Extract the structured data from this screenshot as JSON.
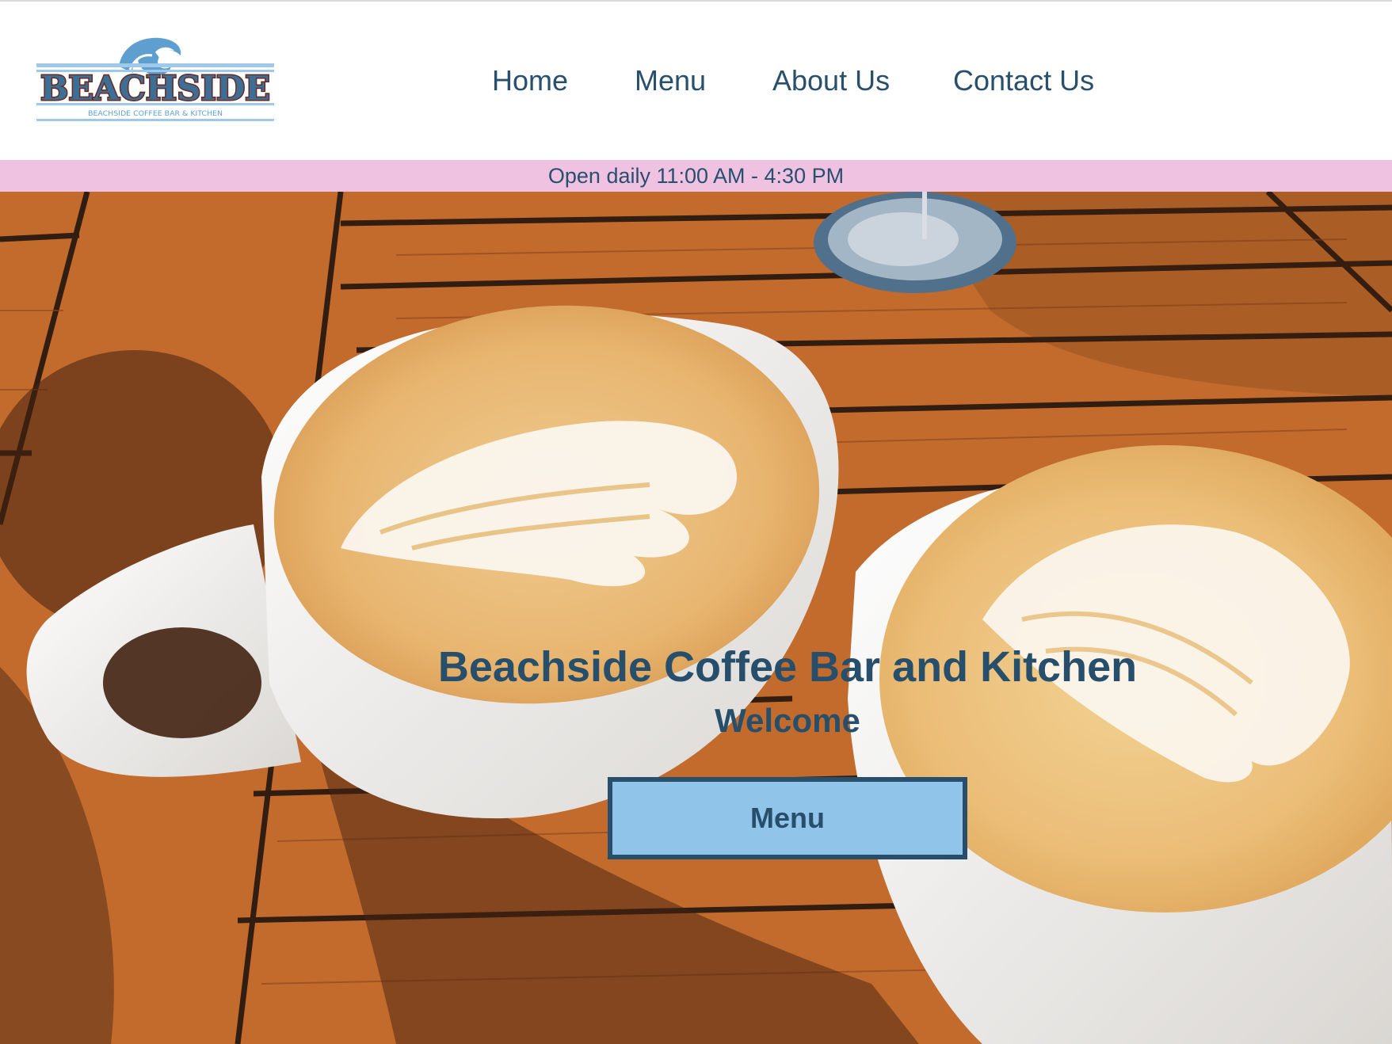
{
  "logo": {
    "wordmark": "BEACHSIDE",
    "tagline": "BEACHSIDE COFFEE BAR & KITCHEN"
  },
  "nav": {
    "items": [
      {
        "label": "Home"
      },
      {
        "label": "Menu"
      },
      {
        "label": "About Us"
      },
      {
        "label": "Contact Us"
      }
    ]
  },
  "hours_banner": "Open daily 11:00 AM - 4:30 PM",
  "hero": {
    "title": "Beachside Coffee Bar and Kitchen",
    "subtitle": "Welcome",
    "button_label": "Menu"
  },
  "colors": {
    "brand_navy": "#284f6c",
    "banner_pink": "#efc2e2",
    "button_blue": "#90c4e9",
    "table_wood": "#b45a1e"
  },
  "icons": {
    "logo_wave": "wave-icon"
  }
}
